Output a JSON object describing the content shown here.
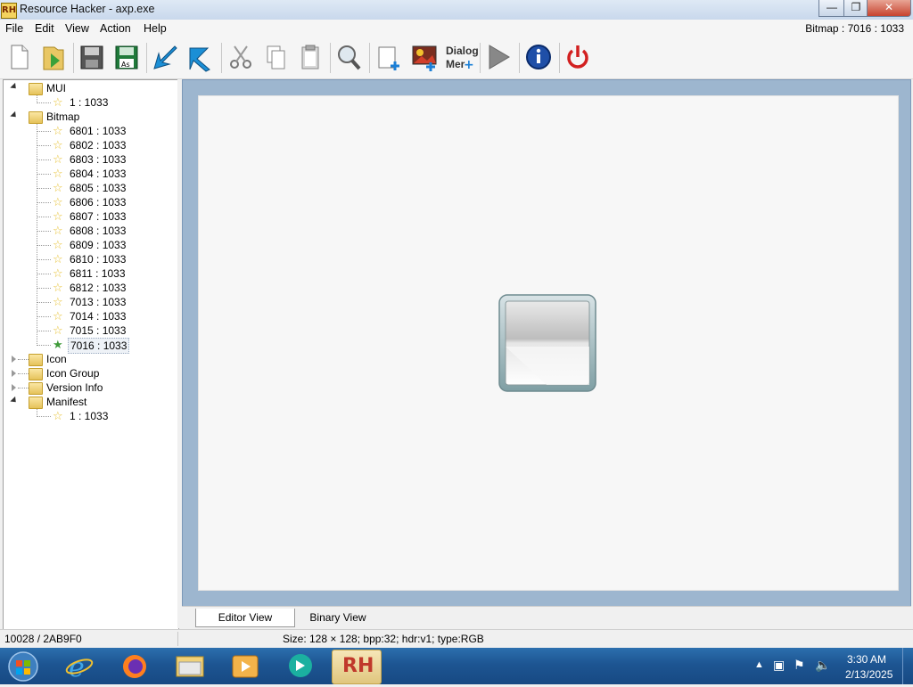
{
  "window": {
    "app_icon": "RH",
    "title": "Resource Hacker - axp.exe",
    "close_glyph": "✕"
  },
  "menu": {
    "items": [
      "File",
      "Edit",
      "View",
      "Action",
      "Help"
    ],
    "right_info": "Bitmap : 7016 : 1033"
  },
  "toolbar": {
    "dialog_merge_label_1": "Dialog",
    "dialog_merge_label_2": "Mer"
  },
  "tree": {
    "groups": [
      {
        "label": "MUI",
        "expanded": true,
        "children": [
          "1 : 1033"
        ]
      },
      {
        "label": "Bitmap",
        "expanded": true,
        "children": [
          "6801 : 1033",
          "6802 : 1033",
          "6803 : 1033",
          "6804 : 1033",
          "6805 : 1033",
          "6806 : 1033",
          "6807 : 1033",
          "6808 : 1033",
          "6809 : 1033",
          "6810 : 1033",
          "6811 : 1033",
          "6812 : 1033",
          "7013 : 1033",
          "7014 : 1033",
          "7015 : 1033",
          "7016 : 1033"
        ],
        "selected": "7016 : 1033"
      },
      {
        "label": "Icon",
        "expanded": false,
        "children": []
      },
      {
        "label": "Icon Group",
        "expanded": false,
        "children": []
      },
      {
        "label": "Version Info",
        "expanded": false,
        "children": []
      },
      {
        "label": "Manifest",
        "expanded": true,
        "children": [
          "1 : 1033"
        ]
      }
    ]
  },
  "tabs": {
    "editor": "Editor View",
    "binary": "Binary View"
  },
  "status": {
    "left": "10028 / 2AB9F0",
    "right": "Size: 128 × 128;  bpp:32;  hdr:v1;  type:RGB"
  },
  "taskbar": {
    "rh_label": "RH",
    "time": "3:30 AM",
    "date": "2/13/2025"
  }
}
